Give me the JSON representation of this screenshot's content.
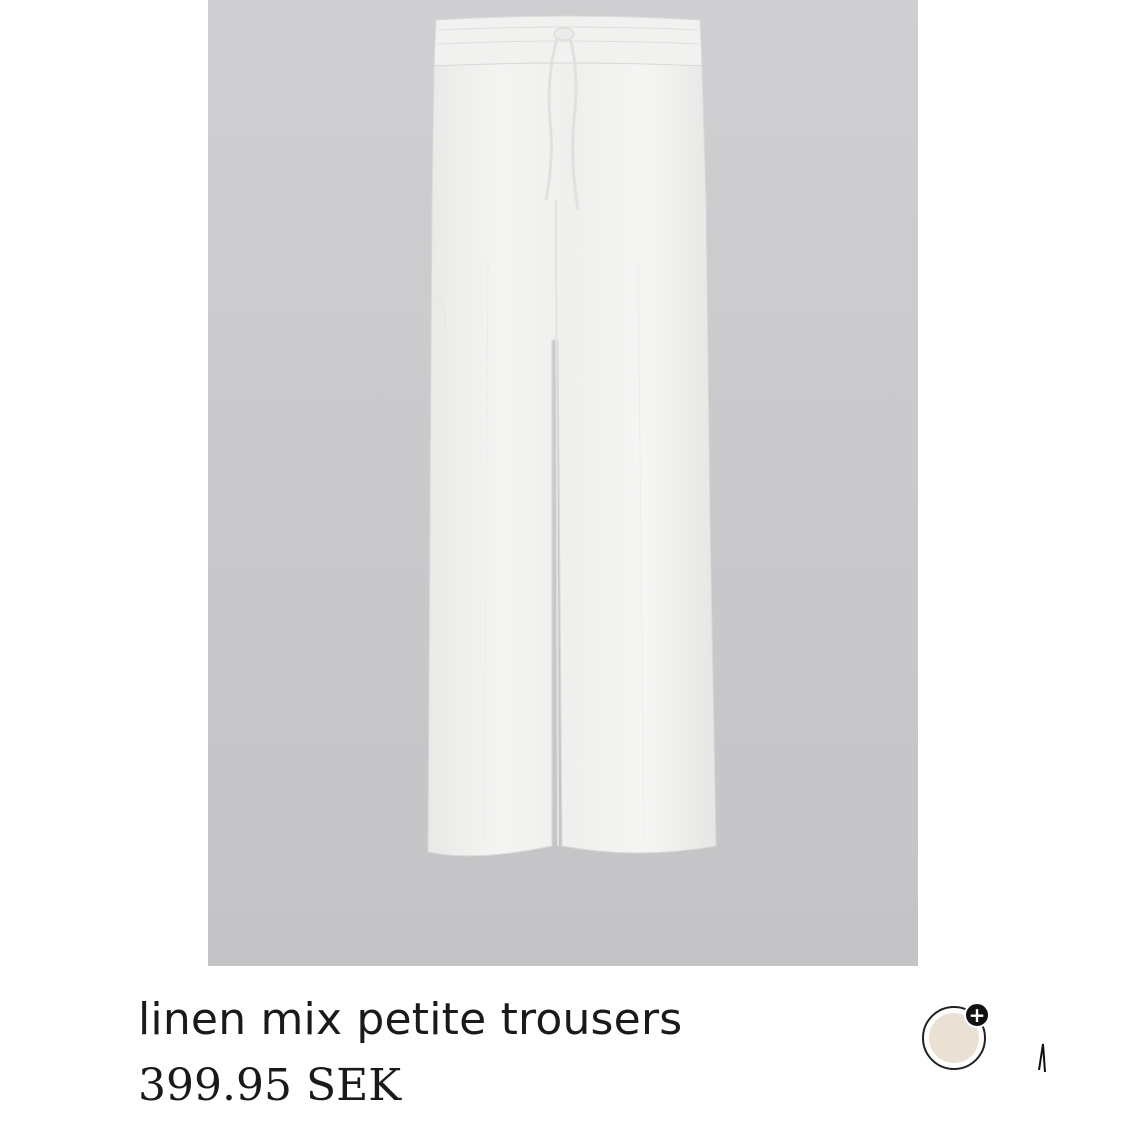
{
  "product": {
    "title": "linen mix petite trousers",
    "price": "399.95 SEK",
    "image_background": "#c9c9cc",
    "garment_color": "#f3f4f2"
  },
  "swatch": {
    "color": "#eae0d4",
    "badge_symbol": "+",
    "icon": "plus-icon"
  }
}
